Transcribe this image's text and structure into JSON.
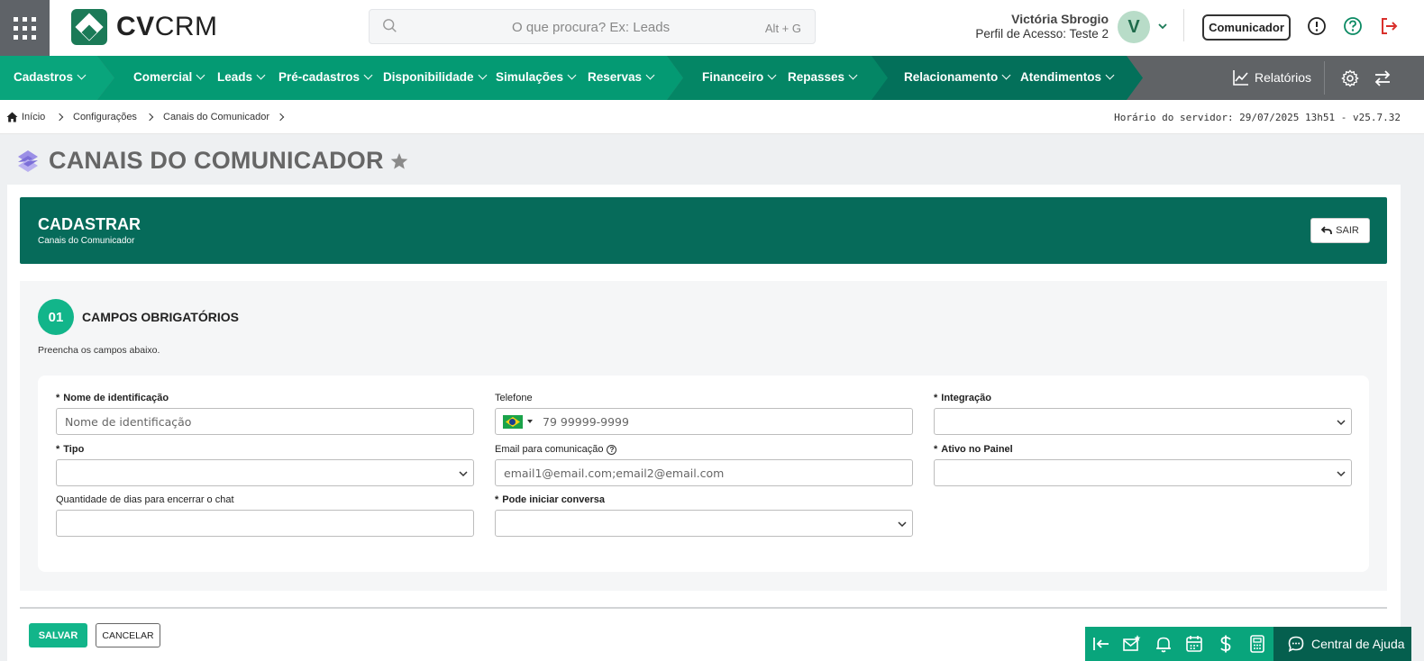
{
  "brand": {
    "name_bold": "CV",
    "name_light": "CRM"
  },
  "search": {
    "placeholder": "O que procura? Ex: Leads",
    "shortcut": "Alt + G"
  },
  "user": {
    "name": "Victória Sbrogio",
    "profile": "Perfil de Acesso: Teste 2",
    "initial": "V"
  },
  "header": {
    "communicator_label": "Comunicador"
  },
  "nav": {
    "items": [
      "Cadastros",
      "Comercial",
      "Leads",
      "Pré-cadastros",
      "Disponibilidade",
      "Simulações",
      "Reservas",
      "Financeiro",
      "Repasses",
      "Relacionamento",
      "Atendimentos"
    ],
    "reports": "Relatórios"
  },
  "breadcrumb": {
    "items": [
      "Início",
      "Configurações",
      "Canais do Comunicador"
    ]
  },
  "server_time": "Horário do servidor: 29/07/2025 13h51 - v25.7.32",
  "page": {
    "title": "CANAIS DO COMUNICADOR"
  },
  "form_header": {
    "title": "CADASTRAR",
    "subtitle": "Canais do Comunicador",
    "exit_label": "SAIR"
  },
  "section": {
    "step": "01",
    "title": "CAMPOS OBRIGATÓRIOS",
    "subtitle": "Preencha os campos abaixo."
  },
  "fields": {
    "nome": {
      "label": "Nome de identificação",
      "placeholder": "Nome de identificação",
      "required": "*"
    },
    "telefone": {
      "label": "Telefone",
      "placeholder": "79 99999-9999"
    },
    "integracao": {
      "label": "Integração",
      "required": "*"
    },
    "tipo": {
      "label": "Tipo",
      "required": "*"
    },
    "email": {
      "label": "Email para comunicação",
      "placeholder": "email1@email.com;email2@email.com",
      "help": "?"
    },
    "ativo": {
      "label": "Ativo no Painel",
      "required": "*"
    },
    "dias": {
      "label": "Quantidade de dias para encerrar o chat"
    },
    "pode_iniciar": {
      "label": "Pode iniciar conversa",
      "required": "*"
    }
  },
  "actions": {
    "save": "SALVAR",
    "cancel": "CANCELAR"
  },
  "help_center": {
    "label": "Central de Ajuda"
  },
  "colors": {
    "primary": "#12b58a",
    "dark_green": "#066b5a",
    "nav_gray": "#606366"
  }
}
